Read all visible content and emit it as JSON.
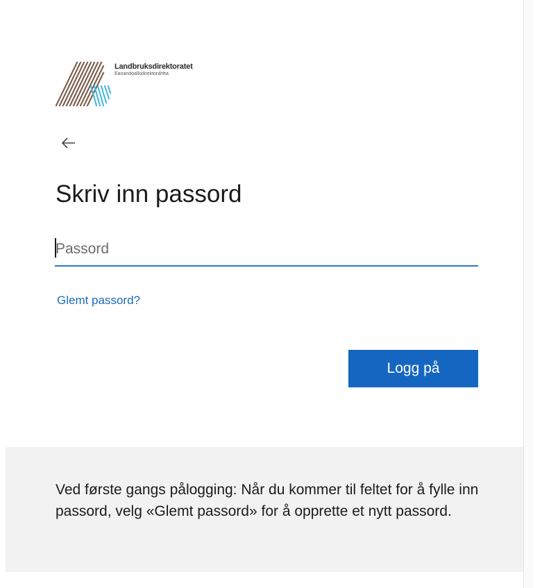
{
  "logo": {
    "name": "Landbruksdirektoratet",
    "subname": "Eanandoallodirektoráhtta",
    "colors": {
      "brown": "#7a5a48",
      "cyan": "#3fb7dc"
    }
  },
  "nav": {
    "back_icon": "arrow-left-icon"
  },
  "page": {
    "title": "Skriv inn passord"
  },
  "form": {
    "password_placeholder": "Passord",
    "forgot_password_label": "Glemt passord?",
    "signin_label": "Logg på"
  },
  "info": {
    "text": "Ved første gangs pålogging: Når du kommer til feltet for å fylle inn passord, velg «Glemt passord» for å opprette et nytt passord."
  },
  "colors": {
    "accent": "#1566c0",
    "link": "#1a6ac3",
    "input_underline": "#2f77c9",
    "panel_bg": "#f2f2f2"
  }
}
